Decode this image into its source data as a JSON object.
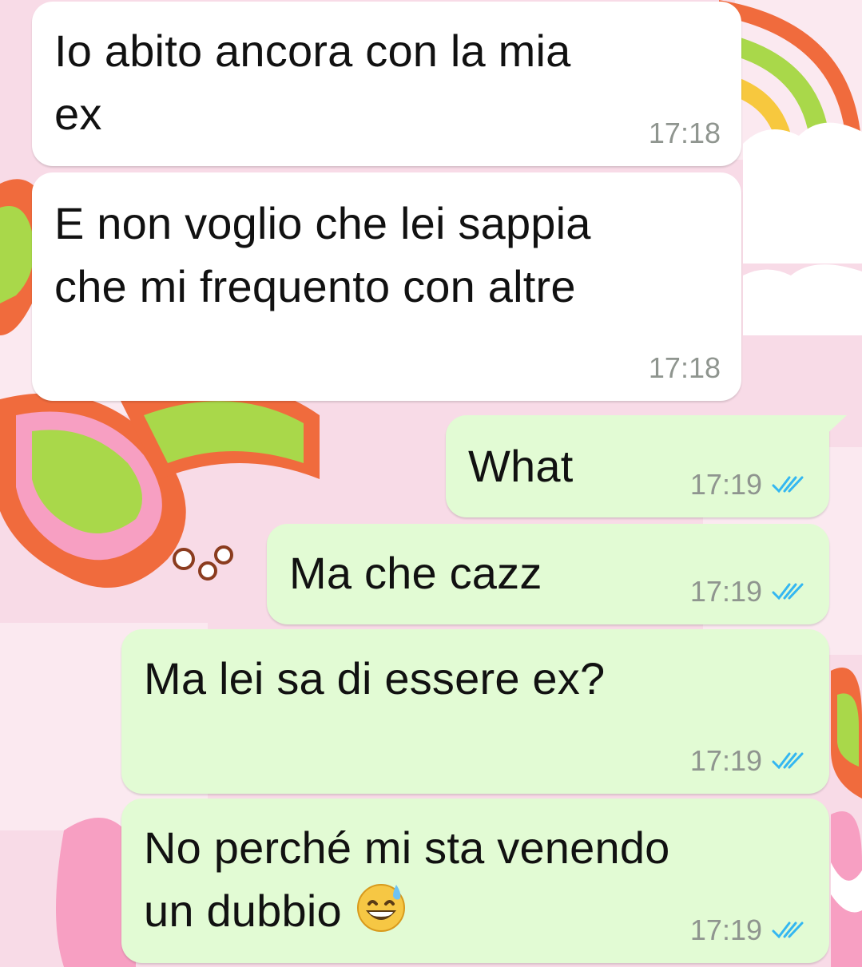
{
  "messages": [
    {
      "direction": "incoming",
      "text": "Io abito ancora con la mia\nex",
      "time": "17:18"
    },
    {
      "direction": "incoming",
      "text": "E non voglio che lei sappia\nche mi frequento con altre",
      "time": "17:18"
    },
    {
      "direction": "outgoing",
      "text": "What",
      "time": "17:19",
      "status": "read"
    },
    {
      "direction": "outgoing",
      "text": "Ma che cazz",
      "time": "17:19",
      "status": "read"
    },
    {
      "direction": "outgoing",
      "text": "Ma lei sa di essere ex?",
      "time": "17:19",
      "status": "read"
    },
    {
      "direction": "outgoing",
      "text": "No perché mi sta venendo\nun dubbio",
      "emoji": "grinning-face-with-sweat",
      "time": "17:19",
      "status": "read"
    }
  ],
  "colors": {
    "incoming_bubble": "#ffffff",
    "outgoing_bubble": "#e2fbd4",
    "timestamp": "#8f958f",
    "read_ticks": "#34b7f1"
  },
  "icons": {
    "read_receipt": "double-check-icon",
    "wallpaper": "retro-butterfly-rainbow-pattern"
  }
}
